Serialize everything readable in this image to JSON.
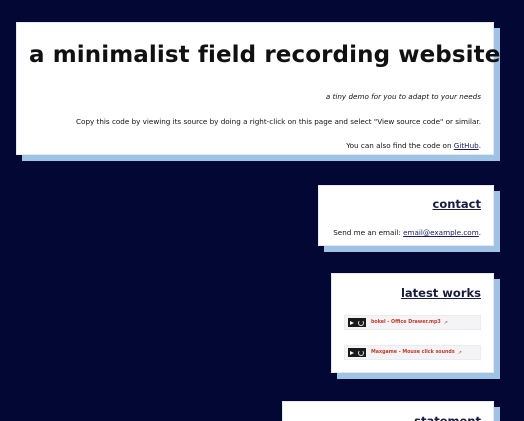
{
  "header": {
    "title": "a minimalist field recording website",
    "tagline": "a tiny demo for you to adapt to your needs",
    "copy_note": "Copy this code by viewing its source by doing a right-click on this page and select \"View source code\" or similar.",
    "code_note_prefix": "You can also find the code on ",
    "code_link": "GitHub",
    "code_note_suffix": "."
  },
  "contact": {
    "heading": "contact",
    "text_prefix": "Send me an email: ",
    "email": "email@example.com",
    "text_suffix": "."
  },
  "latest_works": {
    "heading": "latest works",
    "tracks": [
      {
        "title": "bokel - Office Drawer.mp3",
        "ext_icon": "external-link-icon"
      },
      {
        "title": "Maxgame - Mouse click sounds",
        "ext_icon": "external-link-icon"
      }
    ]
  },
  "statement": {
    "heading": "statement"
  },
  "colors": {
    "background": "#020833",
    "card": "#ffffff",
    "card_shadow": "#9ec3e3",
    "link": "#1a1a66",
    "track_text": "#c0392b"
  }
}
